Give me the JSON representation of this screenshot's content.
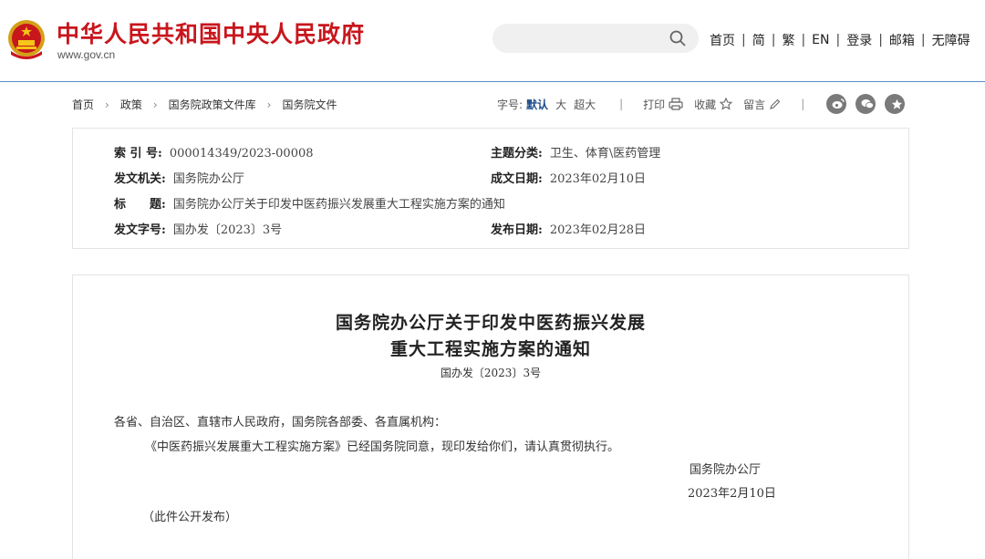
{
  "header": {
    "site_name": "中华人民共和国中央人民政府",
    "site_domain": "www.gov.cn",
    "search": {
      "placeholder": ""
    },
    "nav": [
      "首页",
      "简",
      "繁",
      "EN",
      "登录",
      "邮箱",
      "无障碍"
    ],
    "separator": "|"
  },
  "breadcrumb": {
    "items": [
      "首页",
      "政策",
      "国务院政策文件库",
      "国务院文件"
    ],
    "arrow": "›"
  },
  "toolbar": {
    "font_size_label": "字号:",
    "font_sizes": [
      "默认",
      "大",
      "超大"
    ],
    "active_font_size": "默认",
    "print_label": "打印",
    "favorite_label": "收藏",
    "comment_label": "留言",
    "divider": "|",
    "share_icons": [
      "weibo-icon",
      "wechat-icon",
      "star-icon"
    ]
  },
  "meta": {
    "index_no": {
      "key": "索 引 号:",
      "value": "000014349/2023-00008"
    },
    "topic": {
      "key": "主题分类:",
      "value": "卫生、体育\\医药管理"
    },
    "issuer": {
      "key": "发文机关:",
      "value": "国务院办公厅"
    },
    "written_date": {
      "key": "成文日期:",
      "value": "2023年02月10日"
    },
    "title": {
      "key": "标　　题:",
      "value": "国务院办公厅关于印发中医药振兴发展重大工程实施方案的通知"
    },
    "doc_no": {
      "key": "发文字号:",
      "value": "国办发〔2023〕3号"
    },
    "publish_date": {
      "key": "发布日期:",
      "value": "2023年02月28日"
    }
  },
  "article": {
    "title_line1": "国务院办公厅关于印发中医药振兴发展",
    "title_line2": "重大工程实施方案的通知",
    "doc_no": "国办发〔2023〕3号",
    "salutation": "各省、自治区、直辖市人民政府，国务院各部委、各直属机构：",
    "body": "《中医药振兴发展重大工程实施方案》已经国务院同意，现印发给你们，请认真贯彻执行。",
    "signature": "国务院办公厅",
    "sign_date": "2023年2月10日",
    "note": "（此件公开发布）"
  },
  "colors": {
    "brand_red": "#c8161d",
    "header_rule": "#5b8fc7",
    "active_link": "#1a4a8a"
  }
}
